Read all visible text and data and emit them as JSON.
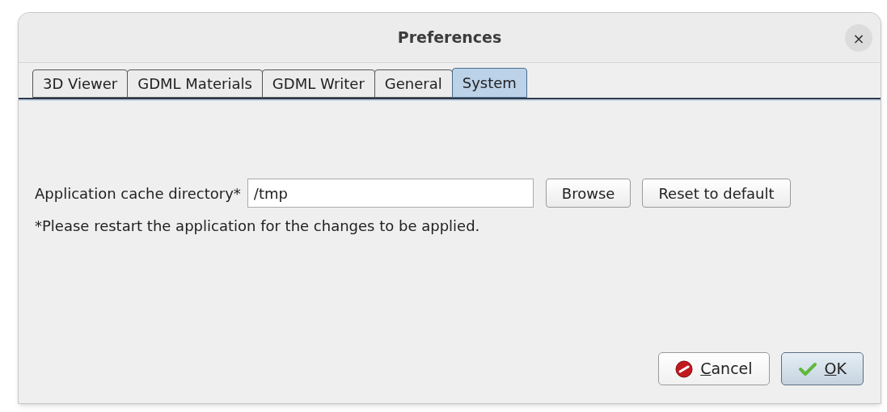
{
  "window": {
    "title": "Preferences",
    "close": "×"
  },
  "tabs": [
    {
      "label": "3D Viewer",
      "selected": false
    },
    {
      "label": "GDML Materials",
      "selected": false
    },
    {
      "label": "GDML Writer",
      "selected": false
    },
    {
      "label": "General",
      "selected": false
    },
    {
      "label": "System",
      "selected": true
    }
  ],
  "cache_directory": {
    "label": "Application cache directory*",
    "value": "/tmp",
    "buttons": [
      "Browse",
      "Reset to default"
    ]
  },
  "note": "*Please restart the application for the changes to be applied.",
  "buttons": [
    {
      "kind": "cancel",
      "label": "Cancel",
      "default": false
    },
    {
      "kind": "ok",
      "label": "OK",
      "default": true
    }
  ]
}
